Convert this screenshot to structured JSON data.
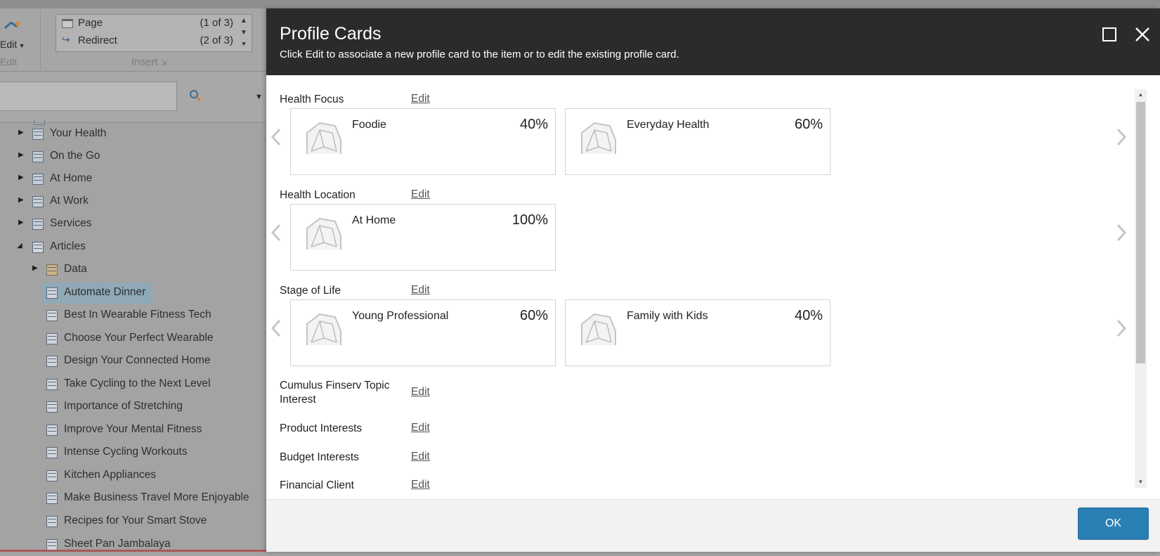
{
  "ribbon": {
    "edit_label": "Edit",
    "edit_group": "Edit",
    "insert_items": [
      {
        "label": "Page",
        "count": "(1 of 3)"
      },
      {
        "label": "Redirect",
        "count": "(2 of 3)"
      }
    ],
    "insert_group": "Insert"
  },
  "tree": {
    "items": [
      {
        "label": "Your Health",
        "icon": "template-icon",
        "expanded": false
      },
      {
        "label": "On the Go",
        "icon": "template-icon",
        "expanded": false
      },
      {
        "label": "At Home",
        "icon": "template-icon",
        "expanded": false
      },
      {
        "label": "At Work",
        "icon": "template-icon",
        "expanded": false
      },
      {
        "label": "Services",
        "icon": "template-icon",
        "expanded": false
      },
      {
        "label": "Articles",
        "icon": "folder-doc-icon",
        "expanded": true
      },
      {
        "label": "Data",
        "icon": "data-folder-icon",
        "expanded": false
      },
      {
        "label": "Automate Dinner",
        "icon": "article-icon",
        "selected": true
      },
      {
        "label": "Best In Wearable Fitness Tech",
        "icon": "article-icon"
      },
      {
        "label": "Choose Your Perfect Wearable",
        "icon": "article-icon"
      },
      {
        "label": "Design Your Connected Home",
        "icon": "article-icon"
      },
      {
        "label": "Take Cycling to the Next Level",
        "icon": "article-icon"
      },
      {
        "label": "Importance of Stretching",
        "icon": "article-icon"
      },
      {
        "label": "Improve Your Mental Fitness",
        "icon": "article-icon"
      },
      {
        "label": "Intense Cycling Workouts",
        "icon": "article-icon"
      },
      {
        "label": "Kitchen Appliances",
        "icon": "article-icon"
      },
      {
        "label": "Make Business Travel More Enjoyable",
        "icon": "article-icon"
      },
      {
        "label": "Recipes for Your Smart Stove",
        "icon": "article-icon"
      },
      {
        "label": "Sheet Pan Jambalaya",
        "icon": "article-icon"
      }
    ]
  },
  "dialog": {
    "title": "Profile Cards",
    "subtitle": "Click Edit to associate a new profile card to the item or to edit the existing profile card.",
    "edit_label": "Edit",
    "ok_label": "OK",
    "profiles": [
      {
        "name": "Health Focus",
        "cards": [
          {
            "name": "Foodie",
            "percent": "40%"
          },
          {
            "name": "Everyday Health",
            "percent": "60%"
          }
        ]
      },
      {
        "name": "Health Location",
        "cards": [
          {
            "name": "At Home",
            "percent": "100%"
          }
        ]
      },
      {
        "name": "Stage of Life",
        "cards": [
          {
            "name": "Young Professional",
            "percent": "60%"
          },
          {
            "name": "Family with Kids",
            "percent": "40%"
          }
        ]
      },
      {
        "name": "Cumulus Finserv Topic Interest",
        "cards": []
      },
      {
        "name": "Product Interests",
        "cards": []
      },
      {
        "name": "Budget Interests",
        "cards": []
      },
      {
        "name": "Financial Client",
        "cards": []
      }
    ]
  },
  "colors": {
    "header_bg": "#2b2b2b",
    "ok_button": "#2a7fb3",
    "selected_tree_item": "#8fa9b6"
  }
}
